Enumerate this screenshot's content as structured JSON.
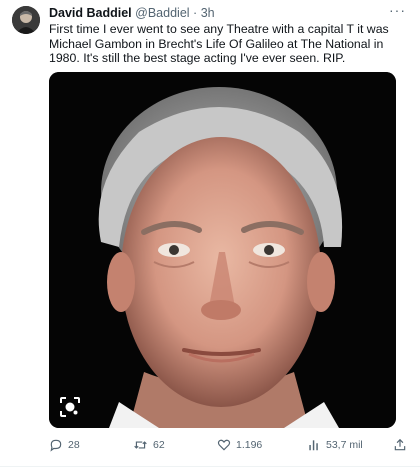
{
  "tweet": {
    "author_name": "David Baddiel",
    "handle": "@Baddiel",
    "separator": "·",
    "time": "3h",
    "more_label": "···",
    "text": "First time I ever went to see any Theatre with a capital T it was Michael Gambon in Brecht's Life Of Galileo at The National in 1980. It's still the best stage acting I've ever seen. RIP.",
    "media_icon": "lens-search-icon"
  },
  "actions": {
    "replies": "28",
    "retweets": "62",
    "likes": "1.196",
    "views": "53,7 mil",
    "icons": [
      "reply-icon",
      "retweet-icon",
      "like-icon",
      "views-icon",
      "share-icon"
    ]
  },
  "colors": {
    "text": "#0f1419",
    "secondary": "#536471",
    "media_bg": "#050505"
  }
}
